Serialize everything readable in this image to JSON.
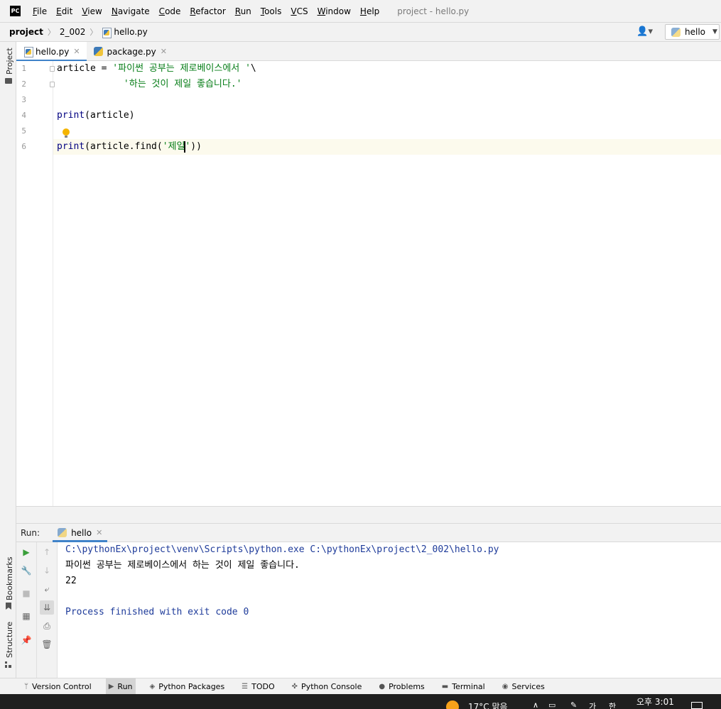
{
  "app": {
    "logo_text": "PC",
    "window_title": "project - hello.py"
  },
  "menu": [
    "File",
    "Edit",
    "View",
    "Navigate",
    "Code",
    "Refactor",
    "Run",
    "Tools",
    "VCS",
    "Window",
    "Help"
  ],
  "breadcrumb": {
    "project": "project",
    "folder": "2_002",
    "file": "hello.py"
  },
  "run_config": {
    "label": "hello"
  },
  "left_stripe": {
    "project": "Project",
    "bookmarks": "Bookmarks",
    "structure": "Structure"
  },
  "editor_tabs": [
    {
      "label": "hello.py",
      "active": true
    },
    {
      "label": "package.py",
      "active": false
    }
  ],
  "editor": {
    "line_numbers": [
      "1",
      "2",
      "3",
      "4",
      "5",
      "6"
    ],
    "current_line": 6,
    "lines": [
      {
        "plain": "article = ",
        "string": "'파이썬 공부는 제로베이스에서 '",
        "tail": "\\"
      },
      {
        "plain": "            ",
        "string": "'하는 것이 제일 좋습니다.'",
        "tail": ""
      },
      {
        "plain": "",
        "string": "",
        "tail": ""
      },
      {
        "fn": "print",
        "plain": "(article)",
        "string": "",
        "tail": ""
      },
      {
        "plain": "",
        "string": "",
        "tail": ""
      },
      {
        "fn": "print",
        "plain": "(article.find(",
        "string_a": "'제일",
        "string_b": "'",
        "tail": "))"
      }
    ]
  },
  "run": {
    "label": "Run:",
    "tab": "hello",
    "console": [
      {
        "kind": "cmd",
        "text": "C:\\pythonEx\\project\\venv\\Scripts\\python.exe C:\\pythonEx\\project\\2_002\\hello.py"
      },
      {
        "kind": "out",
        "text": "파이썬 공부는 제로베이스에서 하는 것이 제일 좋습니다."
      },
      {
        "kind": "out",
        "text": "22"
      },
      {
        "kind": "out",
        "text": ""
      },
      {
        "kind": "cmd",
        "text": "Process finished with exit code 0"
      }
    ]
  },
  "bottom_tools": [
    {
      "label": "Version Control",
      "icon": "branch-icon",
      "active": false
    },
    {
      "label": "Run",
      "icon": "play-icon",
      "active": true
    },
    {
      "label": "Python Packages",
      "icon": "layers-icon",
      "active": false
    },
    {
      "label": "TODO",
      "icon": "list-icon",
      "active": false
    },
    {
      "label": "Python Console",
      "icon": "python-icon",
      "active": false
    },
    {
      "label": "Problems",
      "icon": "info-icon",
      "active": false
    },
    {
      "label": "Terminal",
      "icon": "terminal-icon",
      "active": false
    },
    {
      "label": "Services",
      "icon": "services-icon",
      "active": false
    }
  ],
  "taskbar": {
    "weather": "17°C 맑음",
    "ime_a": "가",
    "ime_b": "한",
    "clock": "오후 3:01"
  }
}
